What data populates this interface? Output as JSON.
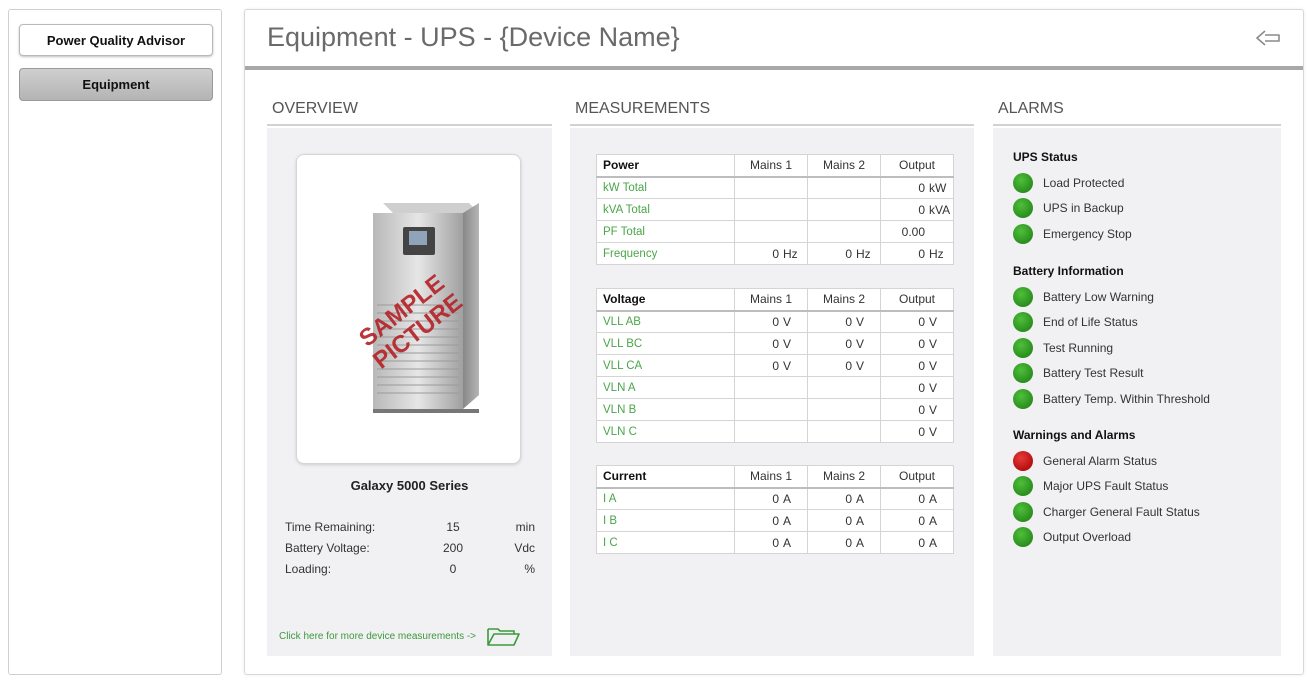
{
  "sidebar": {
    "items": [
      {
        "label": "Power Quality Advisor"
      },
      {
        "label": "Equipment"
      }
    ]
  },
  "header": {
    "title": "Equipment - UPS - {Device Name}",
    "back_icon": "back-arrow-icon"
  },
  "overview": {
    "title": "OVERVIEW",
    "image_stamp": "SAMPLE PICTURE",
    "device_name": "Galaxy 5000 Series",
    "stats": [
      {
        "label": "Time Remaining:",
        "value": "15",
        "unit": "min"
      },
      {
        "label": "Battery Voltage:",
        "value": "200",
        "unit": "Vdc"
      },
      {
        "label": "Loading:",
        "value": "0",
        "unit": "%"
      }
    ],
    "more_link": "Click here for more device measurements ->",
    "folder_icon": "open-folder-icon"
  },
  "measurements": {
    "title": "MEASUREMENTS",
    "tables": [
      {
        "headers": [
          "Power",
          "Mains 1",
          "Mains 2",
          "Output"
        ],
        "rows": [
          {
            "label": "kW Total",
            "cells": [
              {
                "v": "",
                "u": ""
              },
              {
                "v": "",
                "u": ""
              },
              {
                "v": "0",
                "u": "kW"
              }
            ]
          },
          {
            "label": "kVA Total",
            "cells": [
              {
                "v": "",
                "u": ""
              },
              {
                "v": "",
                "u": ""
              },
              {
                "v": "0",
                "u": "kVA"
              }
            ]
          },
          {
            "label": "PF Total",
            "cells": [
              {
                "v": "",
                "u": ""
              },
              {
                "v": "",
                "u": ""
              },
              {
                "v": "0.00",
                "u": ""
              }
            ]
          },
          {
            "label": "Frequency",
            "cells": [
              {
                "v": "0",
                "u": "Hz"
              },
              {
                "v": "0",
                "u": "Hz"
              },
              {
                "v": "0",
                "u": "Hz"
              }
            ]
          }
        ]
      },
      {
        "headers": [
          "Voltage",
          "Mains 1",
          "Mains 2",
          "Output"
        ],
        "rows": [
          {
            "label": "VLL AB",
            "cells": [
              {
                "v": "0",
                "u": "V"
              },
              {
                "v": "0",
                "u": "V"
              },
              {
                "v": "0",
                "u": "V"
              }
            ]
          },
          {
            "label": "VLL BC",
            "cells": [
              {
                "v": "0",
                "u": "V"
              },
              {
                "v": "0",
                "u": "V"
              },
              {
                "v": "0",
                "u": "V"
              }
            ]
          },
          {
            "label": "VLL CA",
            "cells": [
              {
                "v": "0",
                "u": "V"
              },
              {
                "v": "0",
                "u": "V"
              },
              {
                "v": "0",
                "u": "V"
              }
            ]
          },
          {
            "label": "VLN A",
            "cells": [
              {
                "v": "",
                "u": ""
              },
              {
                "v": "",
                "u": ""
              },
              {
                "v": "0",
                "u": "V"
              }
            ]
          },
          {
            "label": "VLN B",
            "cells": [
              {
                "v": "",
                "u": ""
              },
              {
                "v": "",
                "u": ""
              },
              {
                "v": "0",
                "u": "V"
              }
            ]
          },
          {
            "label": "VLN C",
            "cells": [
              {
                "v": "",
                "u": ""
              },
              {
                "v": "",
                "u": ""
              },
              {
                "v": "0",
                "u": "V"
              }
            ]
          }
        ]
      },
      {
        "headers": [
          "Current",
          "Mains 1",
          "Mains 2",
          "Output"
        ],
        "rows": [
          {
            "label": "I A",
            "cells": [
              {
                "v": "0",
                "u": "A"
              },
              {
                "v": "0",
                "u": "A"
              },
              {
                "v": "0",
                "u": "A"
              }
            ]
          },
          {
            "label": "I B",
            "cells": [
              {
                "v": "0",
                "u": "A"
              },
              {
                "v": "0",
                "u": "A"
              },
              {
                "v": "0",
                "u": "A"
              }
            ]
          },
          {
            "label": "I C",
            "cells": [
              {
                "v": "0",
                "u": "A"
              },
              {
                "v": "0",
                "u": "A"
              },
              {
                "v": "0",
                "u": "A"
              }
            ]
          }
        ]
      }
    ]
  },
  "alarms": {
    "title": "ALARMS",
    "groups": [
      {
        "title": "UPS Status",
        "items": [
          {
            "label": "Load Protected",
            "status": "green"
          },
          {
            "label": "UPS in Backup",
            "status": "green"
          },
          {
            "label": "Emergency Stop",
            "status": "green"
          }
        ]
      },
      {
        "title": "Battery Information",
        "items": [
          {
            "label": "Battery Low Warning",
            "status": "green"
          },
          {
            "label": "End of Life Status",
            "status": "green"
          },
          {
            "label": "Test Running",
            "status": "green"
          },
          {
            "label": "Battery Test Result",
            "status": "green"
          },
          {
            "label": "Battery Temp. Within Threshold",
            "status": "green"
          }
        ]
      },
      {
        "title": "Warnings and Alarms",
        "items": [
          {
            "label": "General Alarm Status",
            "status": "red"
          },
          {
            "label": "Major UPS Fault Status",
            "status": "green"
          },
          {
            "label": "Charger General Fault Status",
            "status": "green"
          },
          {
            "label": "Output Overload",
            "status": "green"
          }
        ]
      }
    ]
  },
  "colors": {
    "green_label": "#4aa64a",
    "led_green": "#2a8f1e",
    "led_red": "#b50f0f",
    "panel_bg": "#f1f0f3"
  }
}
